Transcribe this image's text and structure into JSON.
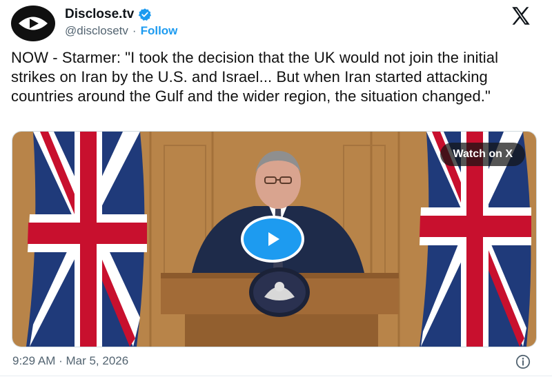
{
  "header": {
    "display_name": "Disclose.tv",
    "handle": "@disclosetv",
    "separator": "·",
    "follow_label": "Follow"
  },
  "tweet": {
    "text": "NOW - Starmer: \"I took the decision that the UK would not join the initial strikes on Iran by the U.S. and Israel... But when Iran started attacking countries around the Gulf and the wider region, the situation changed.\""
  },
  "media": {
    "watch_label": "Watch on X"
  },
  "footer": {
    "timestamp": "9:29 AM · Mar 5, 2026"
  },
  "colors": {
    "accent": "#1d9bf0",
    "text": "#0f1419",
    "muted": "#536471",
    "panel_wood": "#b88449",
    "flag_blue": "#1f3a7a",
    "flag_red": "#c8102e"
  },
  "icons": [
    "disclose-eye-logo-icon",
    "verified-badge-icon",
    "x-logo-icon",
    "play-icon",
    "info-icon"
  ]
}
